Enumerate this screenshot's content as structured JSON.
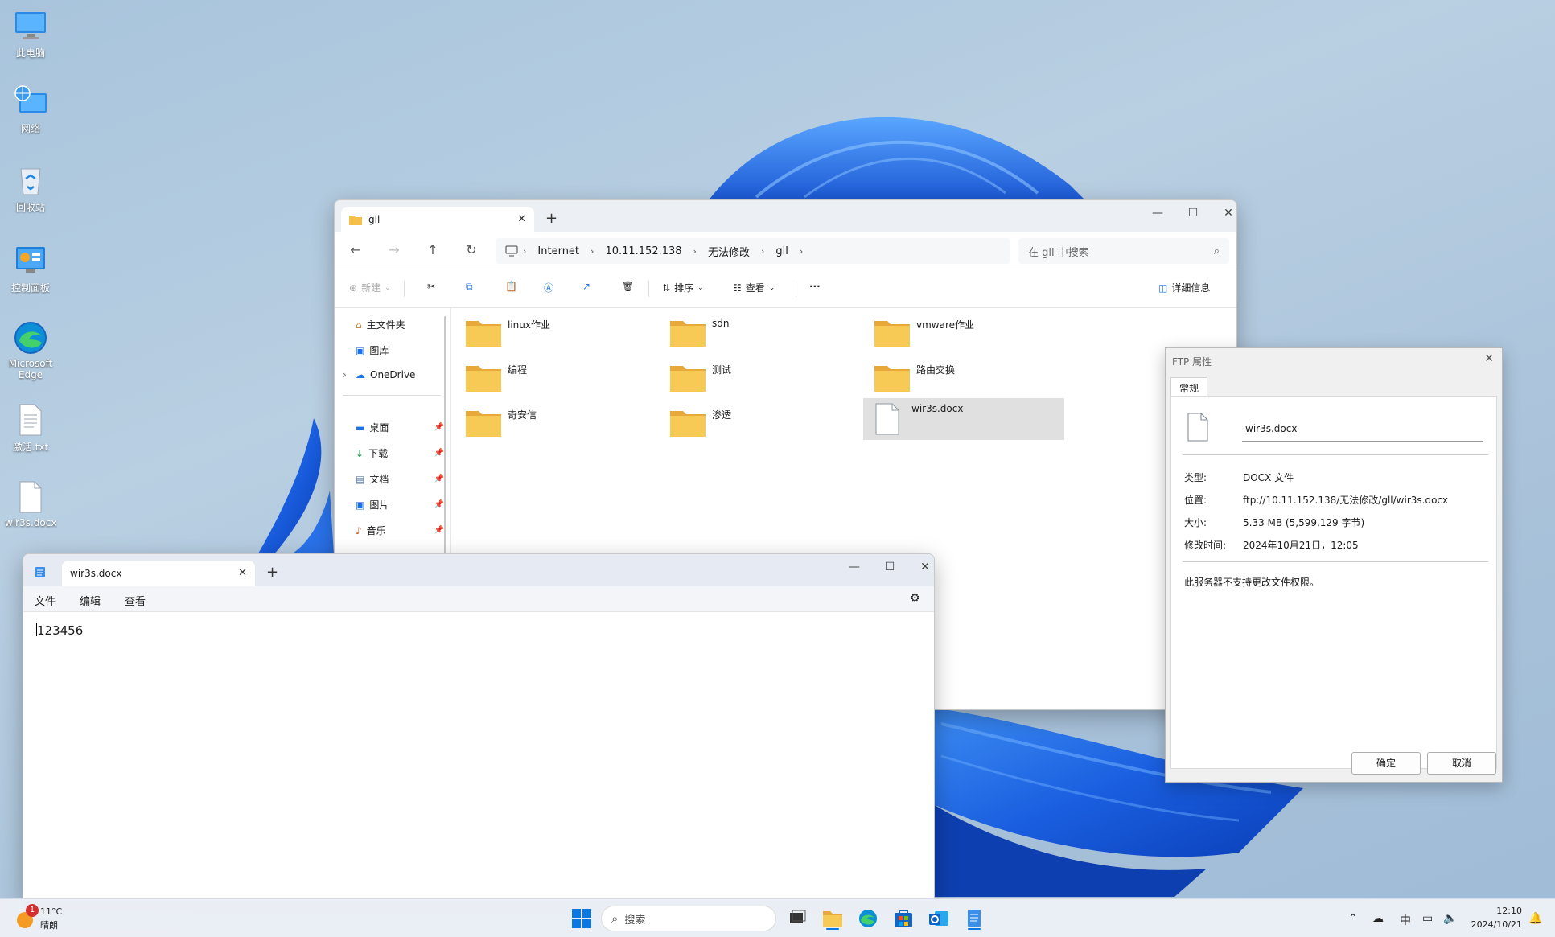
{
  "desktop": {
    "icons": [
      {
        "label": "此电脑"
      },
      {
        "label": "网络"
      },
      {
        "label": "回收站"
      },
      {
        "label": "控制面板"
      },
      {
        "label": "Microsoft Edge"
      },
      {
        "label": "激活.txt"
      },
      {
        "label": "wir3s.docx"
      }
    ]
  },
  "explorer": {
    "tab_title": "gll",
    "breadcrumb": [
      "Internet",
      "10.11.152.138",
      "无法修改",
      "gll"
    ],
    "search_placeholder": "在 gll 中搜索",
    "toolbar": {
      "new_label": "新建",
      "sort_label": "排序",
      "view_label": "查看",
      "more_label": "···",
      "details_label": "详细信息"
    },
    "sidebar": {
      "top": [
        {
          "label": "主文件夹"
        },
        {
          "label": "图库"
        },
        {
          "label": "OneDrive"
        }
      ],
      "quick": [
        {
          "label": "桌面"
        },
        {
          "label": "下载"
        },
        {
          "label": "文档"
        },
        {
          "label": "图片"
        },
        {
          "label": "音乐"
        }
      ]
    },
    "items": [
      {
        "name": "linux作业",
        "kind": "folder"
      },
      {
        "name": "sdn",
        "kind": "folder"
      },
      {
        "name": "vmware作业",
        "kind": "folder"
      },
      {
        "name": "编程",
        "kind": "folder"
      },
      {
        "name": "测试",
        "kind": "folder"
      },
      {
        "name": "路由交换",
        "kind": "folder"
      },
      {
        "name": "奇安信",
        "kind": "folder"
      },
      {
        "name": "渗透",
        "kind": "folder"
      },
      {
        "name": "wir3s.docx",
        "kind": "file"
      }
    ]
  },
  "notepad": {
    "tab_title": "wir3s.docx",
    "menu": [
      "文件",
      "编辑",
      "查看"
    ],
    "content": "123456"
  },
  "properties_dialog": {
    "title": "FTP 属性",
    "tab": "常规",
    "file_name": "wir3s.docx",
    "rows": [
      {
        "label": "类型:",
        "value": "DOCX 文件"
      },
      {
        "label": "位置:",
        "value": "ftp://10.11.152.138/无法修改/gll/wir3s.docx"
      },
      {
        "label": "大小:",
        "value": "5.33 MB (5,599,129 字节)"
      },
      {
        "label": "修改时间:",
        "value": "2024年10月21日，12:05"
      }
    ],
    "note": "此服务器不支持更改文件权限。",
    "ok_label": "确定",
    "cancel_label": "取消"
  },
  "taskbar": {
    "weather_temp": "11°C",
    "weather_desc": "晴朗",
    "weather_badge": "1",
    "search_placeholder": "搜索",
    "ime": "中",
    "time": "12:10",
    "date": "2024/10/21"
  },
  "colors": {
    "accent": "#0067c0",
    "folder": "#f5c04a",
    "wallpaper_bloom": "#1a5fe0"
  }
}
